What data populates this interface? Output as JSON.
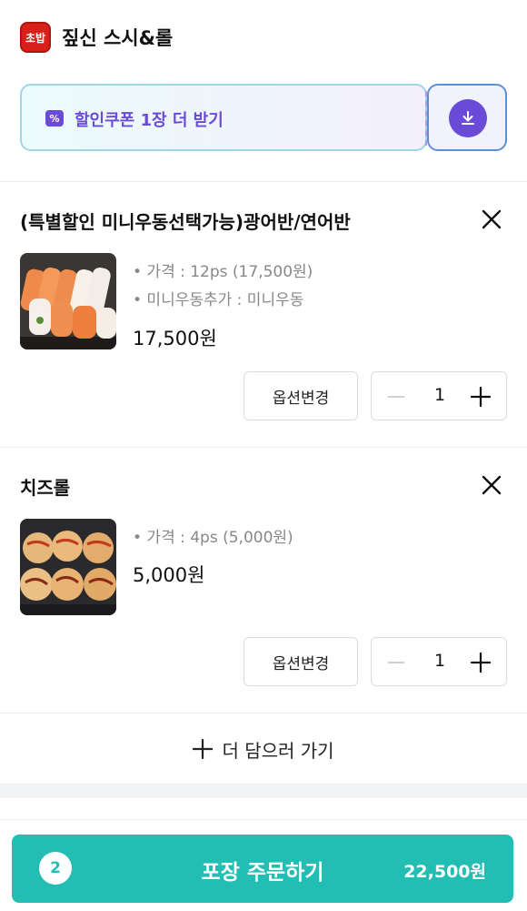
{
  "store": {
    "logo_text": "초밥",
    "name": "짚신 스시&롤"
  },
  "coupon": {
    "label": "할인쿠폰 1장 더 받기",
    "icon": "coupon-percent-icon",
    "action_icon": "download-icon"
  },
  "cart": {
    "items": [
      {
        "name": "(특별할인 미니우동선택가능)광어반/연어반",
        "options": [
          "• 가격 : 12ps (17,500원)",
          "• 미니우동추가 : 미니우동"
        ],
        "price": "17,500원",
        "option_button": "옵션변경",
        "quantity": "1"
      },
      {
        "name": "치즈롤",
        "options": [
          "• 가격 : 4ps (5,000원)"
        ],
        "price": "5,000원",
        "option_button": "옵션변경",
        "quantity": "1"
      }
    ],
    "add_more_label": "더 담으러 가기"
  },
  "order": {
    "count": "2",
    "label": "포장 주문하기",
    "total": "22,500원"
  },
  "colors": {
    "accent_teal": "#22bdb3",
    "coupon_purple": "#6a4bd8",
    "logo_red": "#d8201a"
  }
}
